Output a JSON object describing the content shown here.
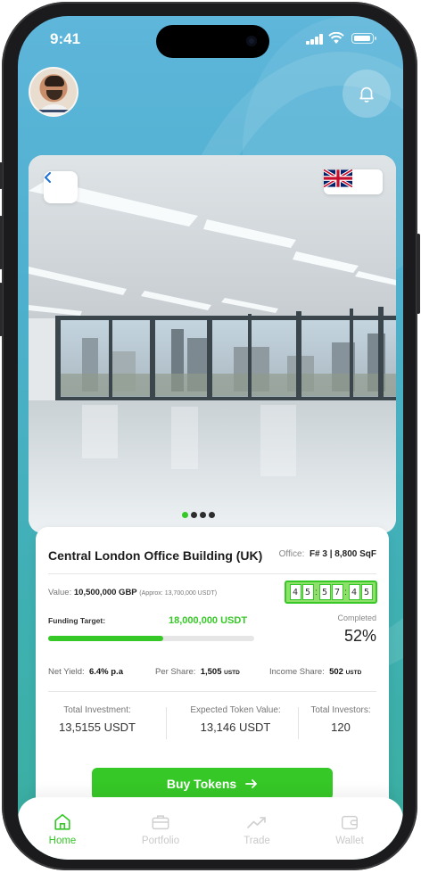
{
  "status_bar": {
    "time": "9:41"
  },
  "hero": {
    "country_code": "UK",
    "slide_count": 4,
    "active_slide": 1
  },
  "property": {
    "name": "Central London Office Building (UK)",
    "office_label": "Office:",
    "office_details": "F# 3 | 8,800 SqF",
    "value_label": "Value:",
    "value": "10,500,000 GBP",
    "value_approx": "(Approx: 13,700,000 USDT)",
    "timer_digits": [
      "4",
      "5",
      "5",
      "7",
      "4",
      "5"
    ],
    "funding_target_label": "Funding Target:",
    "funding_target": "18,000,000 USDT",
    "completed_label": "Completed",
    "completed_percent": "52%",
    "progress_fraction": 0.56,
    "net_yield_label": "Net Yield:",
    "net_yield": "6.4% p.a",
    "per_share_label": "Per Share:",
    "per_share": "1,505",
    "per_share_unit": "USTD",
    "income_share_label": "Income Share:",
    "income_share": "502",
    "income_share_unit": "USTD"
  },
  "summary": {
    "total_investment_label": "Total Investment:",
    "total_investment": "13,5155 USDT",
    "expected_token_label": "Expected Token Value:",
    "expected_token": "13,146 USDT",
    "total_investors_label": "Total Investors:",
    "total_investors": "120"
  },
  "buy_button": {
    "label": "Buy Tokens"
  },
  "tabs": [
    {
      "label": "Home",
      "icon": "home-icon",
      "active": true
    },
    {
      "label": "Portfolio",
      "icon": "briefcase-icon",
      "active": false
    },
    {
      "label": "Trade",
      "icon": "trend-icon",
      "active": false
    },
    {
      "label": "Wallet",
      "icon": "wallet-icon",
      "active": false
    }
  ],
  "colors": {
    "accent": "#36c827",
    "background_top": "#5eb6da",
    "background_bottom": "#3aae9f"
  }
}
